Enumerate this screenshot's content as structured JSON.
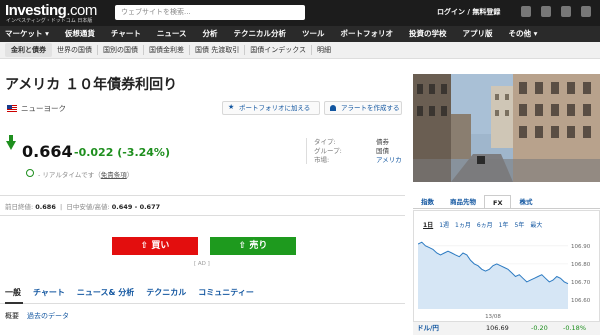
{
  "header": {
    "logo_main": "Investing",
    "logo_com": ".com",
    "tagline": "インベスティング・ドットコム 日本版",
    "search_placeholder": "ウェブサイトを検索...",
    "login": "ログイン / 無料登録"
  },
  "nav": [
    "マーケット ▾",
    "仮想通貨",
    "チャート",
    "ニュース",
    "分析",
    "テクニカル分析",
    "ツール",
    "ポートフォリオ",
    "投資の学校",
    "アプリ版",
    "その他 ▾"
  ],
  "subnav": [
    "金利と債券",
    "世界の国債",
    "国別の国債",
    "国債金利差",
    "国債 先渡取引",
    "国債インデックス",
    "明細"
  ],
  "instrument": {
    "title": "アメリカ １０年債券利回り",
    "exchange": "ニューヨーク",
    "add_portfolio": "ポートフォリオに加える",
    "create_alert": "アラートを作成する",
    "price": "0.664",
    "change": "-0.022",
    "change_pct": "(-3.24%)",
    "realtime": "- リアルタイムです（",
    "realtime_link": "免責条項",
    "realtime_end": "）",
    "meta_labels": [
      "タイプ:",
      "グループ:",
      "市場:"
    ],
    "meta_values": [
      "債券",
      "国債",
      "アメリカ"
    ],
    "prev_close_label": "前日終値:",
    "prev_close": "0.686",
    "day_range_label": "日中安値/高値:",
    "day_range": "0.649 - 0.677",
    "buy": "買い",
    "sell": "売り",
    "ad": "[ AD ]"
  },
  "tabs": [
    "一般",
    "チャート",
    "ニュース& 分析",
    "テクニカル",
    "コミュニティー"
  ],
  "subtabs": [
    "概要",
    "過去のデータ"
  ],
  "widget": {
    "tabs": [
      "指数",
      "商品先物",
      "FX",
      "株式"
    ],
    "active_tab": "FX",
    "periods": [
      "1日",
      "1週",
      "1ヵ月",
      "6ヵ月",
      "1年",
      "5年",
      "最大"
    ],
    "active_period": "1日",
    "fx": {
      "pair": "ドル/円",
      "price": "106.69",
      "change": "-0.20",
      "change_pct": "-0.18%"
    }
  },
  "chart_data": {
    "type": "area",
    "x_ticks": [
      "13/08"
    ],
    "y_ticks": [
      "106.90",
      "106.80",
      "106.70",
      "106.60"
    ],
    "ylim": [
      106.55,
      106.96
    ],
    "values": [
      106.91,
      106.92,
      106.9,
      106.89,
      106.88,
      106.86,
      106.85,
      106.86,
      106.87,
      106.86,
      106.85,
      106.84,
      106.86,
      106.85,
      106.82,
      106.8,
      106.79,
      106.77,
      106.76,
      106.77,
      106.79,
      106.8,
      106.79,
      106.78,
      106.77,
      106.75,
      106.73,
      106.74,
      106.72,
      106.7,
      106.71,
      106.72,
      106.73,
      106.74,
      106.72,
      106.7,
      106.71,
      106.73,
      106.72,
      106.7,
      106.69
    ],
    "colors": {
      "line": "#2d7bc2",
      "fill": "#d6e6f5"
    }
  }
}
